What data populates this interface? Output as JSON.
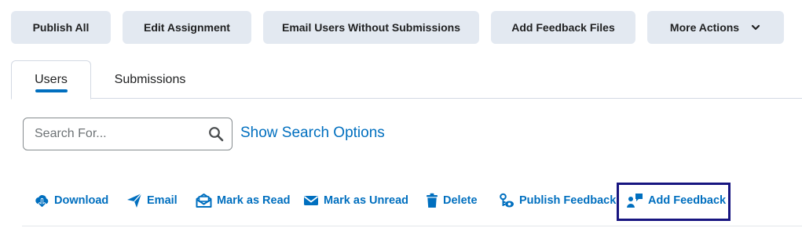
{
  "toolbar": {
    "publish_all": "Publish All",
    "edit_assignment": "Edit Assignment",
    "email_users": "Email Users Without Submissions",
    "add_feedback_files": "Add Feedback Files",
    "more_actions": "More Actions"
  },
  "tabs": {
    "users": "Users",
    "submissions": "Submissions",
    "active": "Users"
  },
  "search": {
    "placeholder": "Search For...",
    "value": "",
    "options_link": "Show Search Options"
  },
  "actions": {
    "download": "Download",
    "email": "Email",
    "mark_read": "Mark as Read",
    "mark_unread": "Mark as Unread",
    "delete": "Delete",
    "publish_feedback": "Publish Feedback",
    "add_feedback": "Add Feedback"
  },
  "colors": {
    "accent": "#006fbf",
    "button_bg": "#e3e9f1",
    "highlight_border": "#171580"
  }
}
